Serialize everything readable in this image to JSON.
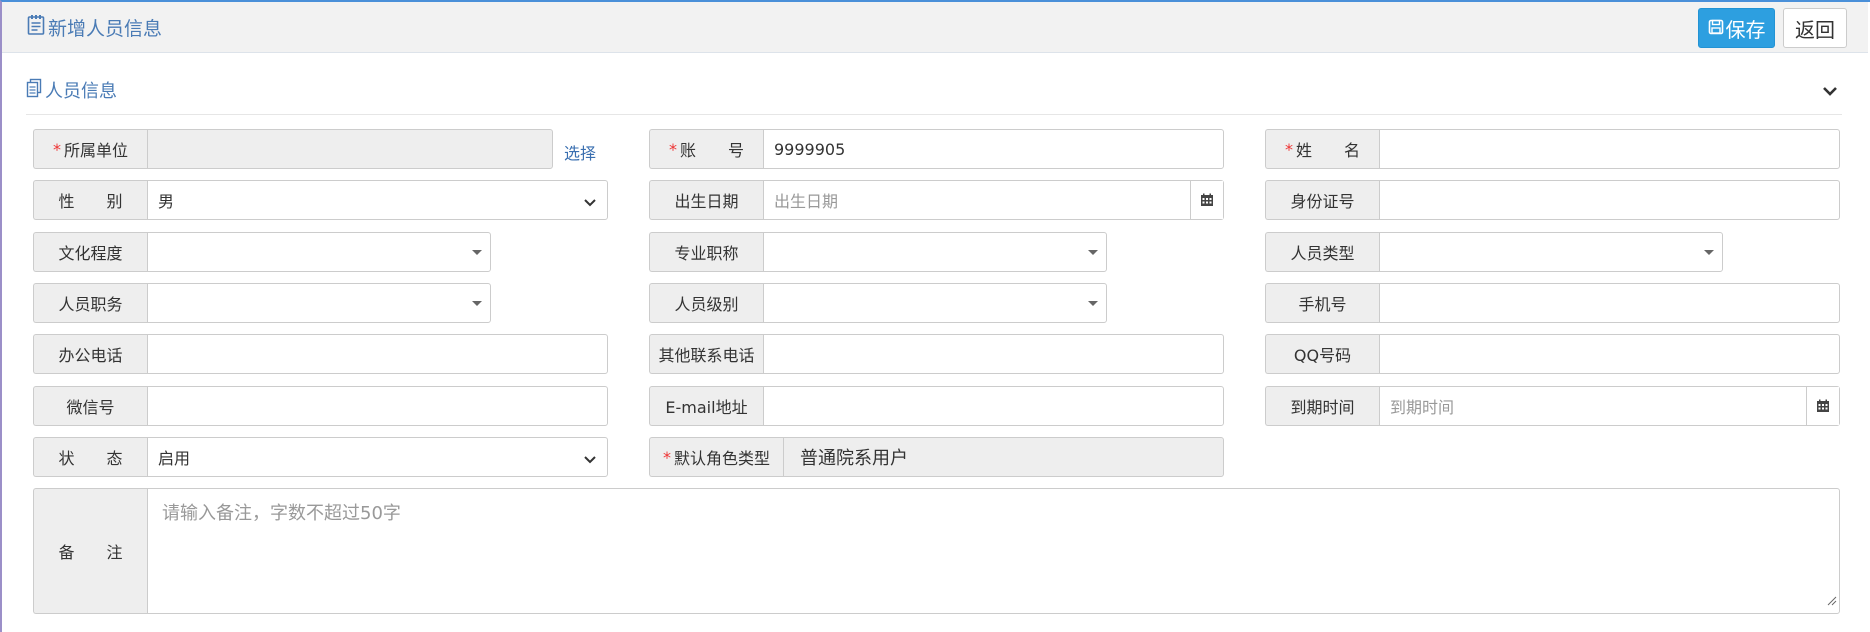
{
  "header": {
    "title": "新增人员信息",
    "save_label": "保存",
    "back_label": "返回"
  },
  "section": {
    "title": "人员信息"
  },
  "fields": {
    "unit": {
      "label": "所属单位",
      "value": "",
      "pick": "选择"
    },
    "account": {
      "label": "账　　号",
      "value": "9999905"
    },
    "name": {
      "label": "姓　　名",
      "value": ""
    },
    "gender": {
      "label": "性　　别",
      "value": "男"
    },
    "birthdate": {
      "label": "出生日期",
      "placeholder": "出生日期"
    },
    "idcard": {
      "label": "身份证号",
      "value": ""
    },
    "education": {
      "label": "文化程度",
      "value": ""
    },
    "title": {
      "label": "专业职称",
      "value": ""
    },
    "ptype": {
      "label": "人员类型",
      "value": ""
    },
    "duty": {
      "label": "人员职务",
      "value": ""
    },
    "level": {
      "label": "人员级别",
      "value": ""
    },
    "mobile": {
      "label": "手机号",
      "value": ""
    },
    "office_phone": {
      "label": "办公电话",
      "value": ""
    },
    "other_phone": {
      "label": "其他联系电话",
      "value": ""
    },
    "qq": {
      "label": "QQ号码",
      "value": ""
    },
    "wechat": {
      "label": "微信号",
      "value": ""
    },
    "email": {
      "label": "E-mail地址",
      "value": ""
    },
    "expire": {
      "label": "到期时间",
      "placeholder": "到期时间"
    },
    "status": {
      "label": "状　　态",
      "value": "启用"
    },
    "role": {
      "label": "默认角色类型",
      "value": "普通院系用户"
    },
    "remark": {
      "label": "备　　注",
      "placeholder": "请输入备注，字数不超过50字"
    }
  },
  "required_mark": "*",
  "icons": {
    "header": "form-icon",
    "section": "copy-icon",
    "collapse": "chevron-down-icon",
    "calendar": "calendar-icon",
    "save": "floppy-icon"
  },
  "colors": {
    "accent": "#2d9fe0",
    "title": "#4a7bb5",
    "required": "#e33333"
  }
}
